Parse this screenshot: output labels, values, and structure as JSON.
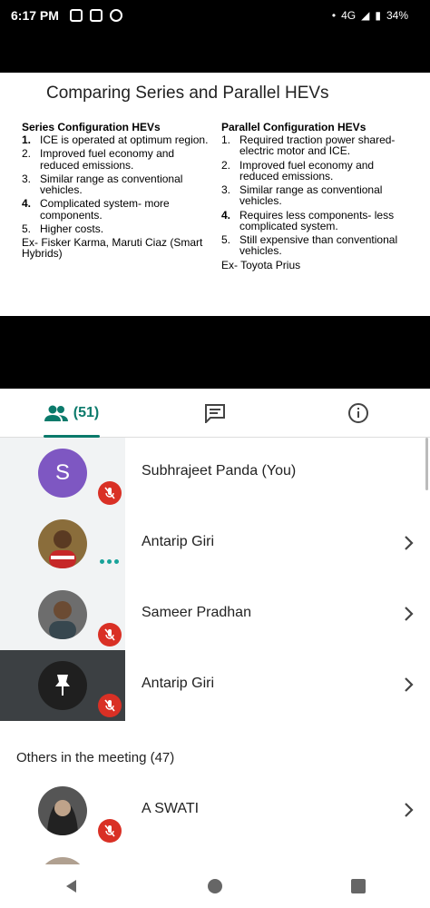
{
  "status_bar": {
    "time": "6:17 PM",
    "battery": "34%",
    "network": "4G"
  },
  "slide": {
    "title": "Comparing Series and Parallel HEVs",
    "series": {
      "heading": "Series Configuration HEVs",
      "items": [
        "ICE is operated at optimum region.",
        "Improved fuel economy and reduced emissions.",
        "Similar range as conventional vehicles.",
        "Complicated system- more components.",
        "Higher costs."
      ],
      "example": "Ex- Fisker Karma, Maruti Ciaz (Smart Hybrids)"
    },
    "parallel": {
      "heading": "Parallel Configuration HEVs",
      "items": [
        "Required traction power shared- electric motor and ICE.",
        "Improved fuel economy and reduced emissions.",
        "Similar range as conventional vehicles.",
        "Requires less components- less complicated system.",
        "Still expensive than conventional vehicles."
      ],
      "example": "Ex- Toyota Prius"
    }
  },
  "tabs": {
    "people_count": "(51)"
  },
  "participants": [
    {
      "name": "Subhrajeet Panda (You)",
      "initial": "S",
      "avatar_color": "#7e57c2",
      "muted": true
    },
    {
      "name": "Antarip Giri",
      "avatar_color": "#8a6d3b",
      "muted": false,
      "speaking": true
    },
    {
      "name": "Sameer Pradhan",
      "avatar_color": "#6d6d6d",
      "muted": true
    },
    {
      "name": "Antarip Giri",
      "avatar_color": "#1f1f1f",
      "muted": true,
      "pinned": true
    }
  ],
  "others_header": "Others in the meeting (47)",
  "others": [
    {
      "name": "A SWATI",
      "avatar_color": "#555555",
      "muted": true
    }
  ],
  "colors": {
    "accent": "#0b7a6b",
    "mic_off": "#d93025"
  }
}
